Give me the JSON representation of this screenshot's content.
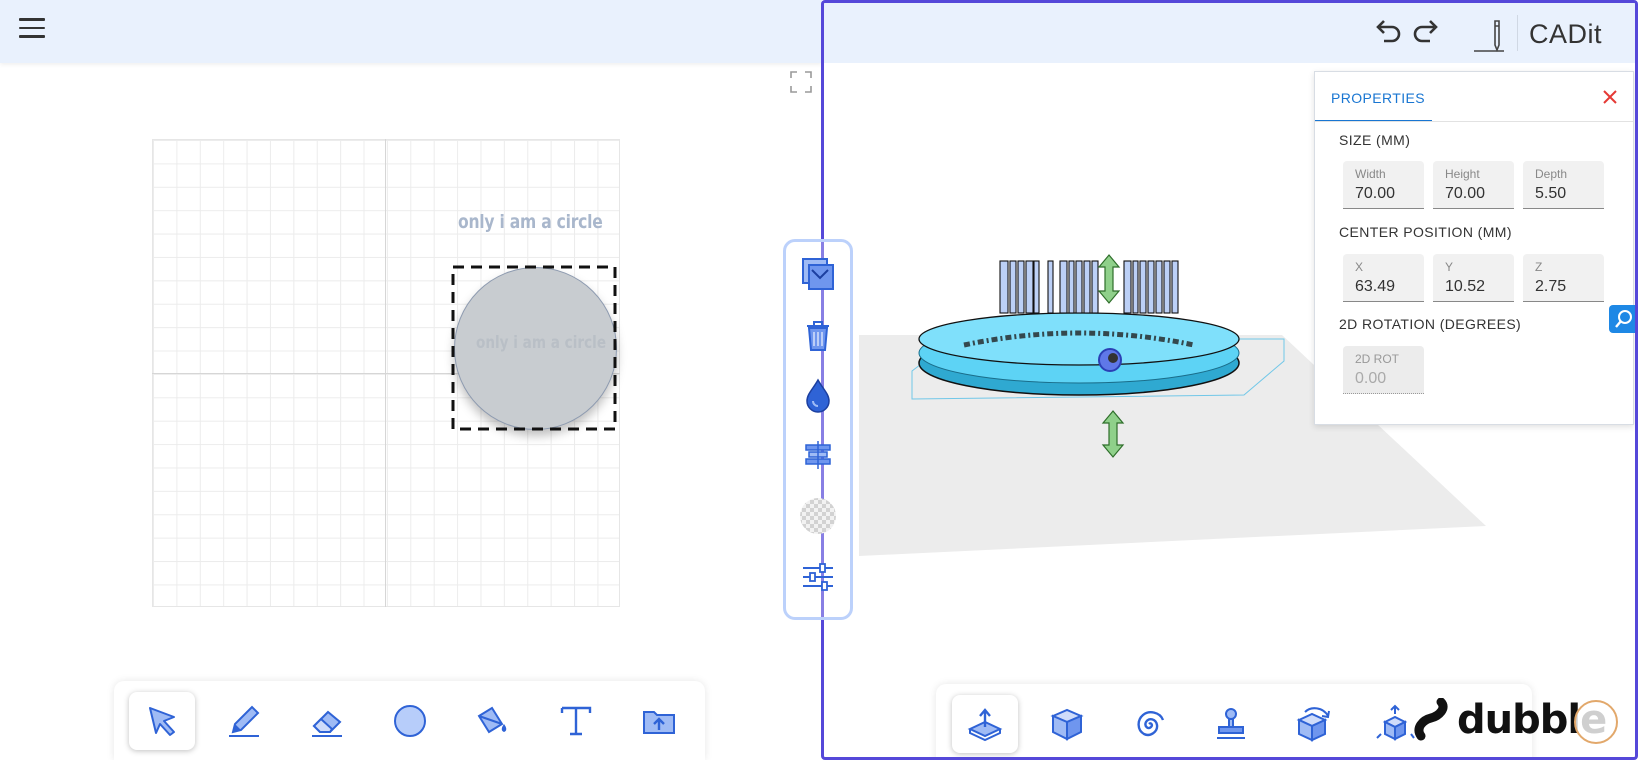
{
  "left_canvas": {
    "shape_label": "only i am a circle",
    "circle_text": "only i am a circle"
  },
  "header": {
    "brand": "CADit"
  },
  "properties": {
    "tab_label": "PROPERTIES",
    "size": {
      "title": "SIZE (MM)",
      "width_label": "Width",
      "width_value": "70.00",
      "height_label": "Height",
      "height_value": "70.00",
      "depth_label": "Depth",
      "depth_value": "5.50"
    },
    "position": {
      "title": "CENTER POSITION (MM)",
      "x_label": "X",
      "x_value": "63.49",
      "y_label": "Y",
      "y_value": "10.52",
      "z_label": "Z",
      "z_value": "2.75"
    },
    "rotation": {
      "title": "2D ROTATION (DEGREES)",
      "rot_label": "2D ROT",
      "rot_value": "0.00"
    }
  },
  "watermark": {
    "text": "dubble"
  },
  "colors": {
    "accent": "#5548d9",
    "tool_blue": "#2f63d6",
    "tool_light": "#9fbbf5",
    "topbar": "#e9f1fd",
    "model_cyan": "#5dd3f5",
    "close_red": "#e53935"
  },
  "icons": {
    "left_tools": [
      "cursor-icon",
      "pencil-icon",
      "eraser-icon",
      "circle-icon",
      "paint-bucket-icon",
      "text-icon",
      "folder-icon"
    ],
    "right_tools": [
      "extrude-icon",
      "box-icon",
      "spiral-icon",
      "stamp-icon",
      "rotate-cube-icon",
      "explode-icon"
    ],
    "vertical_tools": [
      "duplicate-icon",
      "trash-icon",
      "color-drop-icon",
      "align-icon",
      "transparency-icon",
      "sliders-icon"
    ]
  }
}
